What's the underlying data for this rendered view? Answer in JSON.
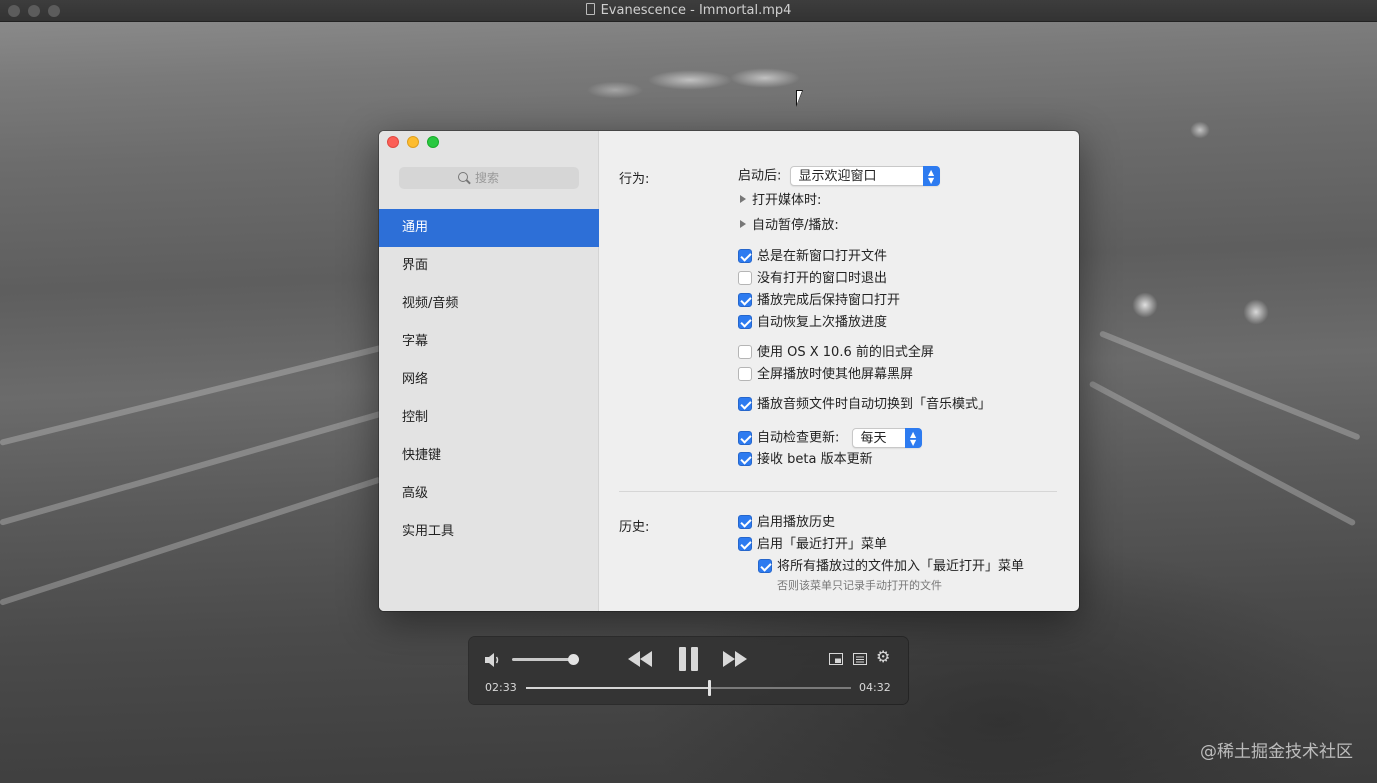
{
  "window": {
    "title": "Evanescence - Immortal.mp4"
  },
  "prefs": {
    "search_placeholder": "搜索",
    "nav": [
      {
        "label": "通用",
        "active": true
      },
      {
        "label": "界面",
        "active": false
      },
      {
        "label": "视频/音频",
        "active": false
      },
      {
        "label": "字幕",
        "active": false
      },
      {
        "label": "网络",
        "active": false
      },
      {
        "label": "控制",
        "active": false
      },
      {
        "label": "快捷键",
        "active": false
      },
      {
        "label": "高级",
        "active": false
      },
      {
        "label": "实用工具",
        "active": false
      }
    ],
    "behavior": {
      "section_label": "行为:",
      "on_launch_label": "启动后:",
      "on_launch_value": "显示欢迎窗口",
      "on_open_media_label": "打开媒体时:",
      "auto_pause_label": "自动暂停/播放:",
      "options": [
        {
          "label": "总是在新窗口打开文件",
          "checked": true
        },
        {
          "label": "没有打开的窗口时退出",
          "checked": false
        },
        {
          "label": "播放完成后保持窗口打开",
          "checked": true
        },
        {
          "label": "自动恢复上次播放进度",
          "checked": true
        },
        {
          "label": "使用 OS X 10.6 前的旧式全屏",
          "checked": false
        },
        {
          "label": "全屏播放时使其他屏幕黑屏",
          "checked": false
        },
        {
          "label": "播放音频文件时自动切换到「音乐模式」",
          "checked": true
        },
        {
          "label": "自动检查更新:",
          "checked": true
        },
        {
          "label": "接收 beta 版本更新",
          "checked": true
        }
      ],
      "update_frequency": "每天"
    },
    "history": {
      "section_label": "历史:",
      "options": [
        {
          "label": "启用播放历史",
          "checked": true
        },
        {
          "label": "启用「最近打开」菜单",
          "checked": true
        },
        {
          "label": "将所有播放过的文件加入「最近打开」菜单",
          "checked": true
        }
      ],
      "hint": "否则该菜单只记录手动打开的文件"
    }
  },
  "player": {
    "elapsed": "02:33",
    "total": "04:32",
    "progress": 0.5625,
    "volume": 0.9
  },
  "credit": "@稀土掘金技术社区",
  "colors": {
    "accent": "#2d6fd7",
    "checkbox_on": "#2d7bf0"
  }
}
